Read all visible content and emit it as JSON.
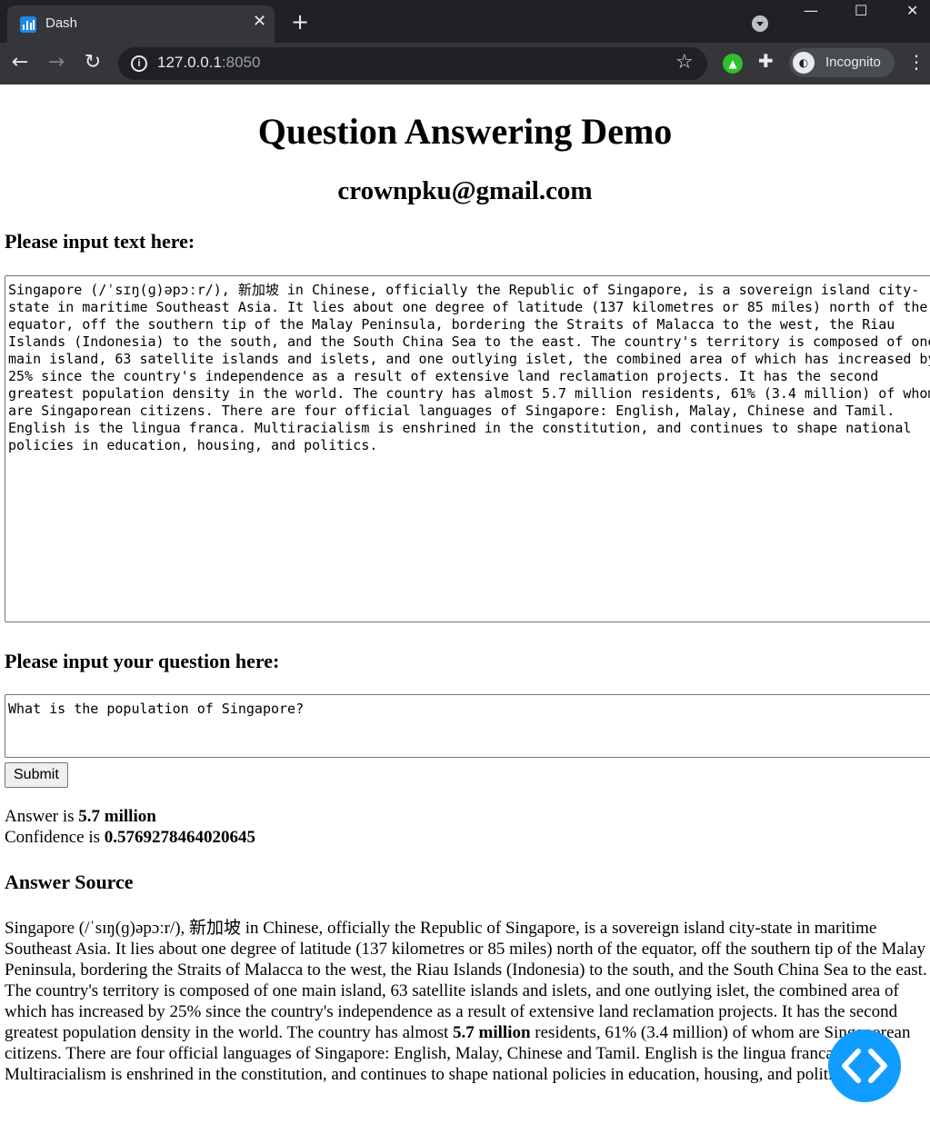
{
  "browser": {
    "tab_title": "Dash",
    "tab_close": "✕",
    "new_tab": "+",
    "url_host": "127.0.0.1",
    "url_port": ":8050",
    "incognito_label": "Incognito",
    "window_minimize": "—",
    "window_maximize": "☐",
    "window_close": "✕"
  },
  "page": {
    "title": "Question Answering Demo",
    "email": "crownpku@gmail.com",
    "text_label": "Please input text here:",
    "text_value": "Singapore (/ˈsɪŋ(ɡ)əpɔːr/), 新加坡 in Chinese, officially the Republic of Singapore, is a sovereign island city-state in maritime Southeast Asia. It lies about one degree of latitude (137 kilometres or 85 miles) north of the equator, off the southern tip of the Malay Peninsula, bordering the Straits of Malacca to the west, the Riau Islands (Indonesia) to the south, and the South China Sea to the east. The country's territory is composed of one main island, 63 satellite islands and islets, and one outlying islet, the combined area of which has increased by 25% since the country's independence as a result of extensive land reclamation projects. It has the second greatest population density in the world. The country has almost 5.7 million residents, 61% (3.4 million) of whom are Singaporean citizens. There are four official languages of Singapore: English, Malay, Chinese and Tamil. English is the lingua franca. Multiracialism is enshrined in the constitution, and continues to shape national policies in education, housing, and politics.",
    "question_label": "Please input your question here:",
    "question_value": "What is the population of Singapore?",
    "submit_label": "Submit",
    "answer_prefix": "Answer is ",
    "answer_value": "5.7 million",
    "confidence_prefix": "Confidence is ",
    "confidence_value": "0.5769278464020645",
    "source_heading": "Answer Source",
    "source_before": "Singapore (/ˈsɪŋ(ɡ)əpɔːr/), 新加坡 in Chinese, officially the Republic of Singapore, is a sovereign island city-state in maritime Southeast Asia. It lies about one degree of latitude (137 kilometres or 85 miles) north of the equator, off the southern tip of the Malay Peninsula, bordering the Straits of Malacca to the west, the Riau Islands (Indonesia) to the south, and the South China Sea to the east. The country's territory is composed of one main island, 63 satellite islands and islets, and one outlying islet, the combined area of which has increased by 25% since the country's independence as a result of extensive land reclamation projects. It has the second greatest population density in the world. The country has almost ",
    "source_highlight": "5.7 million",
    "source_after": " residents, 61% (3.4 million) of whom are Singaporean citizens. There are four official languages of Singapore: English, Malay, Chinese and Tamil. English is the lingua franca. Multiracialism is enshrined in the constitution, and continues to shape national policies in education, housing, and politics."
  },
  "colors": {
    "accent": "#119dff",
    "chrome_dark": "#202124",
    "chrome_toolbar": "#35363a"
  }
}
